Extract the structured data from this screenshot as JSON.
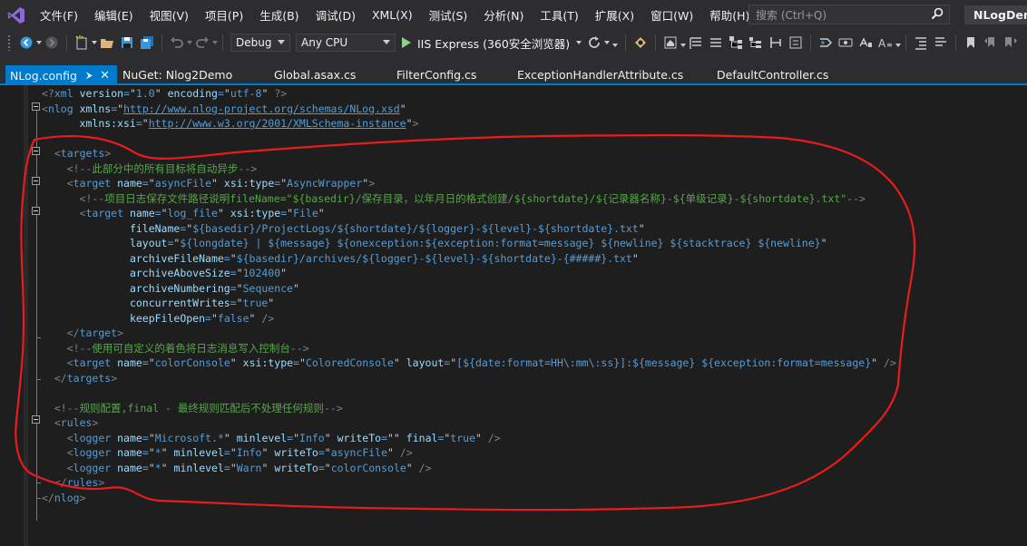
{
  "app": {
    "solution_name": "NLogDem",
    "search_placeholder": "搜索 (Ctrl+Q)"
  },
  "menu": [
    "文件(F)",
    "编辑(E)",
    "视图(V)",
    "项目(P)",
    "生成(B)",
    "调试(D)",
    "XML(X)",
    "测试(S)",
    "分析(N)",
    "工具(T)",
    "扩展(X)",
    "窗口(W)",
    "帮助(H)"
  ],
  "toolbar": {
    "configuration": "Debug",
    "platform": "Any CPU",
    "run_target": "IIS Express (360安全浏览器)"
  },
  "tabs": [
    {
      "label": "NLog.config",
      "active": true
    },
    {
      "label": "NuGet: Nlog2Demo",
      "active": false
    },
    {
      "label": "Global.asax.cs",
      "active": false
    },
    {
      "label": "FilterConfig.cs",
      "active": false
    },
    {
      "label": "ExceptionHandlerAttribute.cs",
      "active": false
    },
    {
      "label": "DefaultController.cs",
      "active": false
    }
  ],
  "code_lines": [
    [
      [
        "p",
        "<?"
      ],
      [
        "t",
        "xml"
      ],
      [
        "w",
        " "
      ],
      [
        "n",
        "version"
      ],
      [
        "t",
        "="
      ],
      [
        "q",
        "\""
      ],
      [
        "t",
        "1.0"
      ],
      [
        "q",
        "\""
      ],
      [
        "w",
        " "
      ],
      [
        "n",
        "encoding"
      ],
      [
        "t",
        "="
      ],
      [
        "q",
        "\""
      ],
      [
        "t",
        "utf-8"
      ],
      [
        "q",
        "\""
      ],
      [
        "w",
        " "
      ],
      [
        "p",
        "?>"
      ]
    ],
    [
      [
        "p",
        "<"
      ],
      [
        "t",
        "nlog"
      ],
      [
        "w",
        " "
      ],
      [
        "n",
        "xmlns"
      ],
      [
        "t",
        "="
      ],
      [
        "q",
        "\""
      ],
      [
        "u",
        "http://www.nlog-project.org/schemas/NLog.xsd"
      ],
      [
        "q",
        "\""
      ]
    ],
    [
      [
        "w",
        "      "
      ],
      [
        "n",
        "xmlns:xsi"
      ],
      [
        "t",
        "="
      ],
      [
        "q",
        "\""
      ],
      [
        "u",
        "http://www.w3.org/2001/XMLSchema-instance"
      ],
      [
        "q",
        "\""
      ],
      [
        "p",
        ">"
      ]
    ],
    [],
    [
      [
        "w",
        "  "
      ],
      [
        "p",
        "<"
      ],
      [
        "t",
        "targets"
      ],
      [
        "p",
        ">"
      ]
    ],
    [
      [
        "w",
        "    "
      ],
      [
        "p",
        "<!--"
      ],
      [
        "c",
        "此部分中的所有目标将自动异步"
      ],
      [
        "p",
        "-->"
      ]
    ],
    [
      [
        "w",
        "    "
      ],
      [
        "p",
        "<"
      ],
      [
        "t",
        "target"
      ],
      [
        "w",
        " "
      ],
      [
        "n",
        "name"
      ],
      [
        "t",
        "="
      ],
      [
        "q",
        "\""
      ],
      [
        "t",
        "asyncFile"
      ],
      [
        "q",
        "\""
      ],
      [
        "w",
        " "
      ],
      [
        "n",
        "xsi:type"
      ],
      [
        "t",
        "="
      ],
      [
        "q",
        "\""
      ],
      [
        "t",
        "AsyncWrapper"
      ],
      [
        "q",
        "\""
      ],
      [
        "p",
        ">"
      ]
    ],
    [
      [
        "w",
        "      "
      ],
      [
        "p",
        "<!--"
      ],
      [
        "c",
        "项目日志保存文件路径说明fileName=\"${basedir}/保存目录，以年月日的格式创建/${shortdate}/${记录器名称}-${单级记录}-${shortdate}.txt\""
      ],
      [
        "p",
        "-->"
      ]
    ],
    [
      [
        "w",
        "      "
      ],
      [
        "p",
        "<"
      ],
      [
        "t",
        "target"
      ],
      [
        "w",
        " "
      ],
      [
        "n",
        "name"
      ],
      [
        "t",
        "="
      ],
      [
        "q",
        "\""
      ],
      [
        "t",
        "log_file"
      ],
      [
        "q",
        "\""
      ],
      [
        "w",
        " "
      ],
      [
        "n",
        "xsi:type"
      ],
      [
        "t",
        "="
      ],
      [
        "q",
        "\""
      ],
      [
        "t",
        "File"
      ],
      [
        "q",
        "\""
      ]
    ],
    [
      [
        "w",
        "              "
      ],
      [
        "n",
        "fileName"
      ],
      [
        "t",
        "="
      ],
      [
        "q",
        "\""
      ],
      [
        "t",
        "${basedir}/ProjectLogs/${shortdate}/${logger}-${level}-${shortdate}.txt"
      ],
      [
        "q",
        "\""
      ]
    ],
    [
      [
        "w",
        "              "
      ],
      [
        "n",
        "layout"
      ],
      [
        "t",
        "="
      ],
      [
        "q",
        "\""
      ],
      [
        "t",
        "${longdate} | ${message} ${onexception:${exception:format=message} ${newline} ${stacktrace} ${newline}"
      ],
      [
        "q",
        "\""
      ]
    ],
    [
      [
        "w",
        "              "
      ],
      [
        "n",
        "archiveFileName"
      ],
      [
        "t",
        "="
      ],
      [
        "q",
        "\""
      ],
      [
        "t",
        "${basedir}/archives/${logger}-${level}-${shortdate}-{#####}.txt"
      ],
      [
        "q",
        "\""
      ]
    ],
    [
      [
        "w",
        "              "
      ],
      [
        "n",
        "archiveAboveSize"
      ],
      [
        "t",
        "="
      ],
      [
        "q",
        "\""
      ],
      [
        "t",
        "102400"
      ],
      [
        "q",
        "\""
      ]
    ],
    [
      [
        "w",
        "              "
      ],
      [
        "n",
        "archiveNumbering"
      ],
      [
        "t",
        "="
      ],
      [
        "q",
        "\""
      ],
      [
        "t",
        "Sequence"
      ],
      [
        "q",
        "\""
      ]
    ],
    [
      [
        "w",
        "              "
      ],
      [
        "n",
        "concurrentWrites"
      ],
      [
        "t",
        "="
      ],
      [
        "q",
        "\""
      ],
      [
        "t",
        "true"
      ],
      [
        "q",
        "\""
      ]
    ],
    [
      [
        "w",
        "              "
      ],
      [
        "n",
        "keepFileOpen"
      ],
      [
        "t",
        "="
      ],
      [
        "q",
        "\""
      ],
      [
        "t",
        "false"
      ],
      [
        "q",
        "\""
      ],
      [
        "w",
        " "
      ],
      [
        "p",
        "/>"
      ]
    ],
    [
      [
        "w",
        "    "
      ],
      [
        "p",
        "</"
      ],
      [
        "t",
        "target"
      ],
      [
        "p",
        ">"
      ]
    ],
    [
      [
        "w",
        "    "
      ],
      [
        "p",
        "<!--"
      ],
      [
        "c",
        "使用可自定义的着色将日志消息写入控制台"
      ],
      [
        "p",
        "-->"
      ]
    ],
    [
      [
        "w",
        "    "
      ],
      [
        "p",
        "<"
      ],
      [
        "t",
        "target"
      ],
      [
        "w",
        " "
      ],
      [
        "n",
        "name"
      ],
      [
        "t",
        "="
      ],
      [
        "q",
        "\""
      ],
      [
        "t",
        "colorConsole"
      ],
      [
        "q",
        "\""
      ],
      [
        "w",
        " "
      ],
      [
        "n",
        "xsi:type"
      ],
      [
        "t",
        "="
      ],
      [
        "q",
        "\""
      ],
      [
        "t",
        "ColoredConsole"
      ],
      [
        "q",
        "\""
      ],
      [
        "w",
        " "
      ],
      [
        "n",
        "layout"
      ],
      [
        "t",
        "="
      ],
      [
        "q",
        "\""
      ],
      [
        "t",
        "[${date:format=HH\\:mm\\:ss}]:${message} ${exception:format=message}"
      ],
      [
        "q",
        "\""
      ],
      [
        "w",
        " "
      ],
      [
        "p",
        "/>"
      ]
    ],
    [
      [
        "w",
        "  "
      ],
      [
        "p",
        "</"
      ],
      [
        "t",
        "targets"
      ],
      [
        "p",
        ">"
      ]
    ],
    [],
    [
      [
        "w",
        "  "
      ],
      [
        "p",
        "<!--"
      ],
      [
        "c",
        "规则配置,final - 最终规则匹配后不处理任何规则"
      ],
      [
        "p",
        "-->"
      ]
    ],
    [
      [
        "w",
        "  "
      ],
      [
        "p",
        "<"
      ],
      [
        "t",
        "rules"
      ],
      [
        "p",
        ">"
      ]
    ],
    [
      [
        "w",
        "    "
      ],
      [
        "p",
        "<"
      ],
      [
        "t",
        "logger"
      ],
      [
        "w",
        " "
      ],
      [
        "n",
        "name"
      ],
      [
        "t",
        "="
      ],
      [
        "q",
        "\""
      ],
      [
        "t",
        "Microsoft.*"
      ],
      [
        "q",
        "\""
      ],
      [
        "w",
        " "
      ],
      [
        "n",
        "minlevel"
      ],
      [
        "t",
        "="
      ],
      [
        "q",
        "\""
      ],
      [
        "t",
        "Info"
      ],
      [
        "q",
        "\""
      ],
      [
        "w",
        " "
      ],
      [
        "n",
        "writeTo"
      ],
      [
        "t",
        "="
      ],
      [
        "q",
        "\"\""
      ],
      [
        "w",
        " "
      ],
      [
        "n",
        "final"
      ],
      [
        "t",
        "="
      ],
      [
        "q",
        "\""
      ],
      [
        "t",
        "true"
      ],
      [
        "q",
        "\""
      ],
      [
        "w",
        " "
      ],
      [
        "p",
        "/>"
      ]
    ],
    [
      [
        "w",
        "    "
      ],
      [
        "p",
        "<"
      ],
      [
        "t",
        "logger"
      ],
      [
        "w",
        " "
      ],
      [
        "n",
        "name"
      ],
      [
        "t",
        "="
      ],
      [
        "q",
        "\""
      ],
      [
        "t",
        "*"
      ],
      [
        "q",
        "\""
      ],
      [
        "w",
        " "
      ],
      [
        "n",
        "minlevel"
      ],
      [
        "t",
        "="
      ],
      [
        "q",
        "\""
      ],
      [
        "t",
        "Info"
      ],
      [
        "q",
        "\""
      ],
      [
        "w",
        " "
      ],
      [
        "n",
        "writeTo"
      ],
      [
        "t",
        "="
      ],
      [
        "q",
        "\""
      ],
      [
        "t",
        "asyncFile"
      ],
      [
        "q",
        "\""
      ],
      [
        "w",
        " "
      ],
      [
        "p",
        "/>"
      ]
    ],
    [
      [
        "w",
        "    "
      ],
      [
        "p",
        "<"
      ],
      [
        "t",
        "logger"
      ],
      [
        "w",
        " "
      ],
      [
        "n",
        "name"
      ],
      [
        "t",
        "="
      ],
      [
        "q",
        "\""
      ],
      [
        "t",
        "*"
      ],
      [
        "q",
        "\""
      ],
      [
        "w",
        " "
      ],
      [
        "n",
        "minlevel"
      ],
      [
        "t",
        "="
      ],
      [
        "q",
        "\""
      ],
      [
        "t",
        "Warn"
      ],
      [
        "q",
        "\""
      ],
      [
        "w",
        " "
      ],
      [
        "n",
        "writeTo"
      ],
      [
        "t",
        "="
      ],
      [
        "q",
        "\""
      ],
      [
        "t",
        "colorConsole"
      ],
      [
        "q",
        "\""
      ],
      [
        "w",
        " "
      ],
      [
        "p",
        "/>"
      ]
    ],
    [
      [
        "w",
        "  "
      ],
      [
        "p",
        "</"
      ],
      [
        "t",
        "rules"
      ],
      [
        "p",
        ">"
      ]
    ],
    [
      [
        "p",
        "</"
      ],
      [
        "t",
        "nlog"
      ],
      [
        "p",
        ">"
      ]
    ]
  ],
  "annotation_color": "#e81c1c"
}
